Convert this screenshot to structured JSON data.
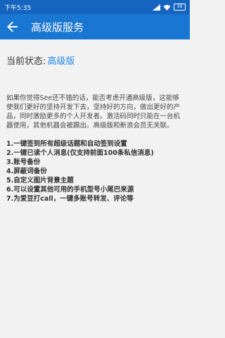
{
  "status_bar": {
    "time": "下午5:35",
    "battery": "39"
  },
  "app_bar": {
    "title": "高级版服务"
  },
  "current_status": {
    "label": "当前状态:",
    "value": "高级版"
  },
  "description": "如果你觉得See还不错的话，能否考虑开通高级版，这能够使我们更好的坚持开发下去，坚持好的方向，做出更好的产品，同时激励更多的个人开发者。激活码同时只能在一台机器使用，其他机器会被踢出。高级版和新浪会员无关联。",
  "features": [
    "1.一键签到所有超级话题和自动签到设置",
    "2.一键已读个人消息(仅支持前面100条私信消息)",
    "3.账号备份",
    "4.屏蔽词备份",
    "5.自定义图片背景主题",
    "6.可以设置其他可用的手机型号小尾巴来源",
    "7.为爱豆打call，一键多账号转发、评论等"
  ],
  "icons": {
    "back": "arrow-back-icon",
    "signal": "signal-icon",
    "wifi": "wifi-icon",
    "battery": "battery-icon"
  },
  "colors": {
    "app_bar": "#1976d2",
    "status_bar": "#1565c0",
    "accent": "#1e88e5",
    "background": "#f2f2f2"
  }
}
